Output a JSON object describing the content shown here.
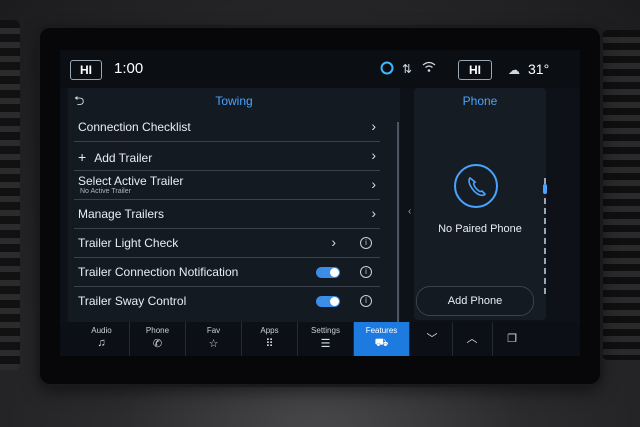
{
  "status": {
    "driver_hi": "HI",
    "time": "1:00",
    "passenger_hi": "HI",
    "temperature": "31°"
  },
  "towing": {
    "back_icon": "back-arrow-icon",
    "title": "Towing",
    "items": [
      {
        "label": "Connection Checklist"
      },
      {
        "label": "Add Trailer"
      },
      {
        "label": "Select Active Trailer",
        "sub": "No Active Trailer"
      },
      {
        "label": "Manage Trailers"
      },
      {
        "label": "Trailer Light Check"
      },
      {
        "label": "Trailer Connection Notification",
        "toggle_on": true
      },
      {
        "label": "Trailer Sway Control",
        "toggle_on": true
      }
    ]
  },
  "phone": {
    "title": "Phone",
    "status": "No Paired Phone",
    "add_button": "Add Phone"
  },
  "nav": {
    "items": [
      {
        "label": "Audio",
        "icon": "music-note-icon"
      },
      {
        "label": "Phone",
        "icon": "phone-icon"
      },
      {
        "label": "Fav",
        "icon": "star-icon"
      },
      {
        "label": "Apps",
        "icon": "grid-icon"
      },
      {
        "label": "Settings",
        "icon": "sliders-icon"
      },
      {
        "label": "Features",
        "icon": "truck-icon",
        "active": true
      }
    ]
  },
  "colors": {
    "accent": "#4aa3ff",
    "active_tab": "#1d7be0",
    "toggle": "#3b8de8"
  }
}
